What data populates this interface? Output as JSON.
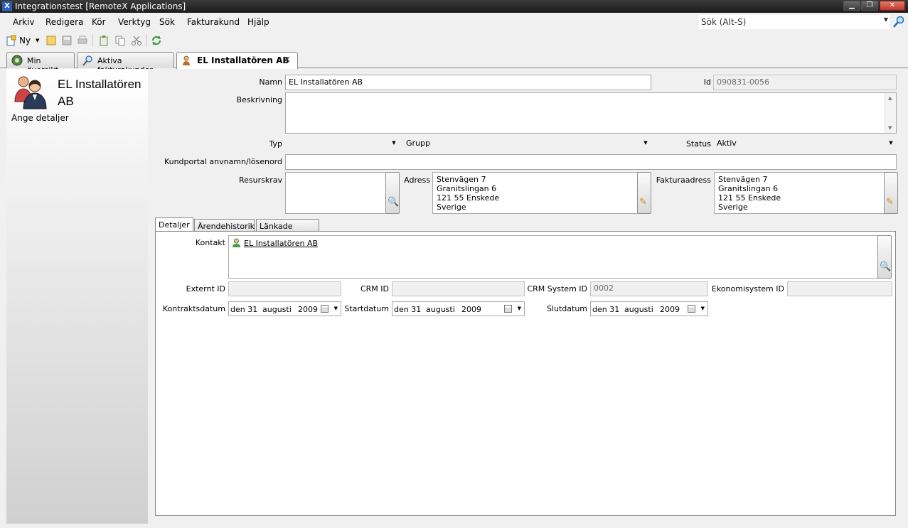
{
  "window": {
    "title": "Integrationstest [RemoteX Applications]",
    "app_icon": "X",
    "minimize_glyph": "▁",
    "maximize_glyph": "❐",
    "close_glyph": "✕"
  },
  "menu": {
    "items": [
      "Arkiv",
      "Redigera",
      "Kör",
      "Verktyg",
      "Sök",
      "Fakturakund",
      "Hjälp"
    ],
    "search_placeholder": "Sök  (Alt-S)",
    "search_dropdown_glyph": "▼",
    "search_icon": "search-icon"
  },
  "toolbar": {
    "new_label": "Ny",
    "dropdown_glyph": "▼"
  },
  "tabs": [
    {
      "label": "Min översikt",
      "icon": "globe-icon"
    },
    {
      "label": "Aktiva fakturakunder",
      "icon": "search-icon"
    },
    {
      "label": "EL Installatören AB",
      "icon": "contact-icon",
      "active": true,
      "close_glyph": "✕"
    }
  ],
  "left_panel": {
    "title": "EL Installatören AB",
    "link": "Ange detaljer"
  },
  "form": {
    "name_label": "Namn",
    "name_value": "EL Installatören AB",
    "id_label": "Id",
    "id_value": "090831-0056",
    "description_label": "Beskrivning",
    "description_value": "",
    "type_label": "Typ",
    "type_value": "",
    "group_label": "Grupp",
    "group_value": "",
    "status_label": "Status",
    "status_value": "Aktiv",
    "portal_label": "Kundportal anvnamn/lösenord",
    "portal_value": "",
    "resource_label": "Resurskrav",
    "address_label": "Adress",
    "address_lines": [
      "Stenvägen 7",
      "Granitslingan 6",
      "121 55 Enskede",
      "Sverige"
    ],
    "invoice_address_label": "Fakturaadress",
    "invoice_address_lines": [
      "Stenvägen 7",
      "Granitslingan 6",
      "121 55 Enskede",
      "Sverige"
    ],
    "dropdown_glyph": "▼",
    "scroll_up_glyph": "▲",
    "scroll_down_glyph": "▼",
    "search_glyph": "🔍",
    "edit_glyph": "✎"
  },
  "subtabs": [
    "Detaljer",
    "Ärendehistorik",
    "Länkade objekt"
  ],
  "details": {
    "contact_label": "Kontakt",
    "contact_value": "EL Installatören AB",
    "external_id_label": "Externt ID",
    "external_id_value": "",
    "crm_id_label": "CRM ID",
    "crm_id_value": "",
    "crm_system_id_label": "CRM System ID",
    "crm_system_id_value": "0002",
    "economy_system_id_label": "Ekonomisystem ID",
    "economy_system_id_value": "",
    "contract_date_label": "Kontraktsdatum",
    "start_date_label": "Startdatum",
    "end_date_label": "Slutdatum",
    "date_dropdown_glyph": "▼",
    "dates": {
      "contract": {
        "day": "den 31",
        "month": "augusti",
        "year": "2009"
      },
      "start": {
        "day": "den 31",
        "month": "augusti",
        "year": "2009"
      },
      "end": {
        "day": "den 31",
        "month": "augusti",
        "year": "2009"
      }
    }
  }
}
